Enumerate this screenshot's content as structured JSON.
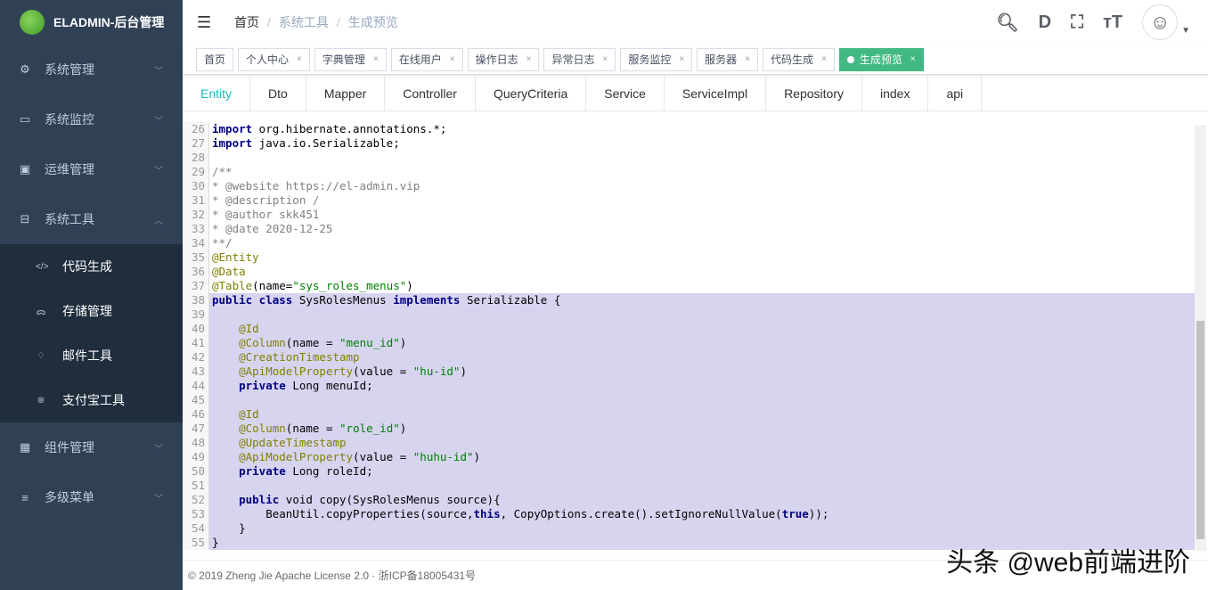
{
  "app": {
    "title": "ELADMIN-后台管理"
  },
  "sidebar": {
    "items": [
      {
        "label": "系统管理",
        "icon": "gear-icon",
        "glyph": "⚙",
        "chev": "﹀"
      },
      {
        "label": "系统监控",
        "icon": "monitor-icon",
        "glyph": "▭",
        "chev": "﹀"
      },
      {
        "label": "运维管理",
        "icon": "server-icon",
        "glyph": "▣",
        "chev": "﹀"
      },
      {
        "label": "系统工具",
        "icon": "tools-icon",
        "glyph": "⊟",
        "chev": "︿"
      }
    ],
    "subitems": [
      {
        "label": "代码生成",
        "icon": "code-icon",
        "glyph": "</>"
      },
      {
        "label": "存储管理",
        "icon": "storage-icon",
        "glyph": "ᯅ"
      },
      {
        "label": "邮件工具",
        "icon": "bell-icon",
        "glyph": "♢"
      },
      {
        "label": "支付宝工具",
        "icon": "alipay-icon",
        "glyph": "⊛"
      }
    ],
    "items2": [
      {
        "label": "组件管理",
        "icon": "grid-icon",
        "glyph": "▦",
        "chev": "﹀"
      },
      {
        "label": "多级菜单",
        "icon": "list-icon",
        "glyph": "≡",
        "chev": "﹀"
      }
    ]
  },
  "breadcrumb": [
    "首页",
    "系统工具",
    "生成预览"
  ],
  "tags": [
    "首页",
    "个人中心",
    "字典管理",
    "在线用户",
    "操作日志",
    "异常日志",
    "服务监控",
    "服务器",
    "代码生成",
    "生成预览"
  ],
  "tabs": [
    "Entity",
    "Dto",
    "Mapper",
    "Controller",
    "QueryCriteria",
    "Service",
    "ServiceImpl",
    "Repository",
    "index",
    "api"
  ],
  "code": {
    "start": 26,
    "sel_from": 38,
    "sel_to": 55,
    "lines": [
      [
        [
          "kw",
          "import"
        ],
        [
          "pl",
          " org.hibernate.annotations.*;"
        ]
      ],
      [
        [
          "kw",
          "import"
        ],
        [
          "pl",
          " java.io.Serializable;"
        ]
      ],
      [],
      [
        [
          "cm",
          "/**"
        ]
      ],
      [
        [
          "cm",
          "* @website https://el-admin.vip"
        ]
      ],
      [
        [
          "cm",
          "* @description /"
        ]
      ],
      [
        [
          "cm",
          "* @author skk451"
        ]
      ],
      [
        [
          "cm",
          "* @date 2020-12-25"
        ]
      ],
      [
        [
          "cm",
          "**/"
        ]
      ],
      [
        [
          "an",
          "@Entity"
        ]
      ],
      [
        [
          "an",
          "@Data"
        ]
      ],
      [
        [
          "an",
          "@Table"
        ],
        [
          "pl",
          "(name="
        ],
        [
          "st",
          "\"sys_roles_menus\""
        ],
        [
          "pl",
          ")"
        ]
      ],
      [
        [
          "kw",
          "public class"
        ],
        [
          "pl",
          " SysRolesMenus "
        ],
        [
          "kw",
          "implements"
        ],
        [
          "pl",
          " Serializable {"
        ]
      ],
      [],
      [
        [
          "pl",
          "    "
        ],
        [
          "an",
          "@Id"
        ]
      ],
      [
        [
          "pl",
          "    "
        ],
        [
          "an",
          "@Column"
        ],
        [
          "pl",
          "(name = "
        ],
        [
          "st",
          "\"menu_id\""
        ],
        [
          "pl",
          ")"
        ]
      ],
      [
        [
          "pl",
          "    "
        ],
        [
          "an",
          "@CreationTimestamp"
        ]
      ],
      [
        [
          "pl",
          "    "
        ],
        [
          "an",
          "@ApiModelProperty"
        ],
        [
          "pl",
          "(value = "
        ],
        [
          "st",
          "\"hu-id\""
        ],
        [
          "pl",
          ")"
        ]
      ],
      [
        [
          "pl",
          "    "
        ],
        [
          "kw",
          "private"
        ],
        [
          "pl",
          " Long menuId;"
        ]
      ],
      [],
      [
        [
          "pl",
          "    "
        ],
        [
          "an",
          "@Id"
        ]
      ],
      [
        [
          "pl",
          "    "
        ],
        [
          "an",
          "@Column"
        ],
        [
          "pl",
          "(name = "
        ],
        [
          "st",
          "\"role_id\""
        ],
        [
          "pl",
          ")"
        ]
      ],
      [
        [
          "pl",
          "    "
        ],
        [
          "an",
          "@UpdateTimestamp"
        ]
      ],
      [
        [
          "pl",
          "    "
        ],
        [
          "an",
          "@ApiModelProperty"
        ],
        [
          "pl",
          "(value = "
        ],
        [
          "st",
          "\"huhu-id\""
        ],
        [
          "pl",
          ")"
        ]
      ],
      [
        [
          "pl",
          "    "
        ],
        [
          "kw",
          "private"
        ],
        [
          "pl",
          " Long roleId;"
        ]
      ],
      [],
      [
        [
          "pl",
          "    "
        ],
        [
          "kw",
          "public"
        ],
        [
          "pl",
          " void copy(SysRolesMenus source){"
        ]
      ],
      [
        [
          "pl",
          "        BeanUtil.copyProperties(source,"
        ],
        [
          "kw",
          "this"
        ],
        [
          "pl",
          ", CopyOptions.create().setIgnoreNullValue("
        ],
        [
          "kw",
          "true"
        ],
        [
          "pl",
          "));"
        ]
      ],
      [
        [
          "pl",
          "    }"
        ]
      ],
      [
        [
          "pl",
          "}"
        ]
      ]
    ]
  },
  "footer": "© 2019 Zheng Jie Apache License 2.0 · 浙ICP备18005431号",
  "watermark": "头条 @web前端进阶",
  "colors": {
    "accent": "#42b983",
    "sidebar": "#304156",
    "tab_active": "#1ebcc3"
  }
}
